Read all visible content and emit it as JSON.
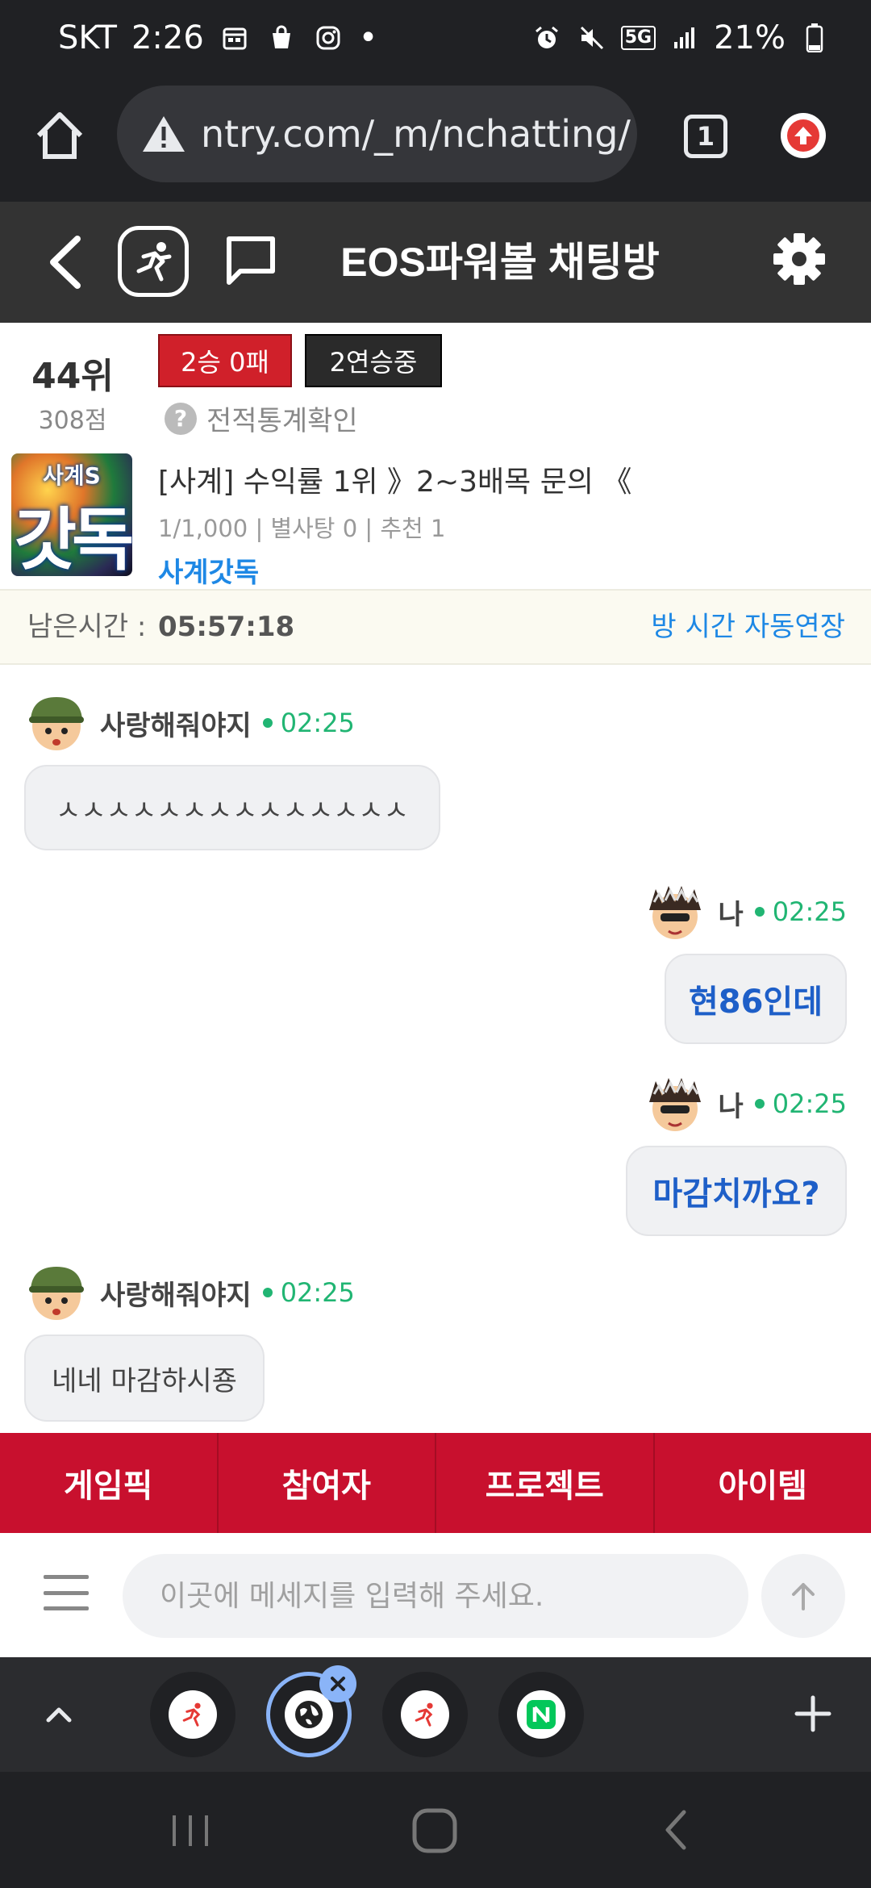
{
  "status_bar": {
    "carrier": "SKT",
    "time": "2:26",
    "dot": "•",
    "network": "5G",
    "battery": "21%",
    "icons": [
      "calendar-icon",
      "shopping-bag-icon",
      "instagram-icon",
      "alarm-icon",
      "mute-icon",
      "signal-icon",
      "battery-icon"
    ]
  },
  "browser": {
    "url": "ntry.com/_m/nchatting/",
    "tab_count": "1"
  },
  "header": {
    "title": "EOS파워볼 채팅방"
  },
  "profile": {
    "rank": "44위",
    "points": "308점",
    "record_badge": "2승 0패",
    "streak_badge": "2연승중",
    "stats_link": "전적통계확인",
    "help_glyph": "?"
  },
  "room": {
    "thumb_top": "사계S",
    "thumb_main": "갓독",
    "title": "[사계] 수익률 1위 》2~3배목 문의 《",
    "meta": "1/1,000 | 별사탕 0 | 추천 1",
    "owner": "사계갓독"
  },
  "timer": {
    "label": "남은시간 :",
    "value": "05:57:18",
    "auto_extend": "방 시간 자동연장"
  },
  "messages": [
    {
      "sender": "사랑해줘야지",
      "time": "02:25",
      "text": "ㅅㅅㅅㅅㅅㅅㅅㅅㅅㅅㅅㅅㅅㅅ",
      "mine": false
    },
    {
      "sender": "나",
      "time": "02:25",
      "text": "현86인데",
      "mine": true
    },
    {
      "sender": "나",
      "time": "02:25",
      "text": "마감치까요?",
      "mine": true
    },
    {
      "sender": "사랑해줘야지",
      "time": "02:25",
      "text": "네네 마감하시죵",
      "mine": false
    }
  ],
  "bottom_tabs": [
    "게임픽",
    "참여자",
    "프로젝트",
    "아이템"
  ],
  "composer": {
    "placeholder": "이곳에 메세지를 입력해 주세요.",
    "value": ""
  },
  "colors": {
    "accent_red": "#c8102e",
    "link_blue": "#1e88e5",
    "online_green": "#21b573"
  }
}
